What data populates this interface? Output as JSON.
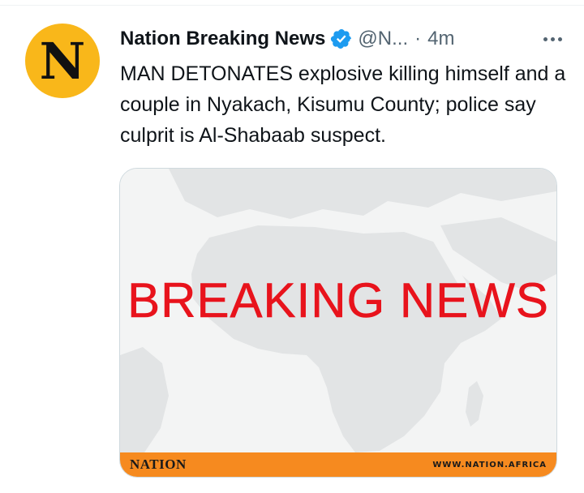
{
  "tweet": {
    "display_name": "Nation Breaking News",
    "handle": "@N...",
    "separator": "·",
    "time": "4m",
    "verified_icon": "verified-badge-icon",
    "more_icon": "more-options-icon",
    "text": "MAN DETONATES explosive killing himself and a couple in Nyakach, Kisumu County; police say culprit is Al-Shabaab suspect."
  },
  "avatar": {
    "letter": "N",
    "background": "#f9b71a"
  },
  "media": {
    "headline": "BREAKING NEWS",
    "brand": "NATION",
    "site": "WWW.NATION.AFRICA",
    "headline_color": "#e8131c",
    "bar_color": "#f68a1f"
  },
  "colors": {
    "verified": "#1d9bf0",
    "secondary_text": "#536471",
    "primary_text": "#0f1419"
  }
}
